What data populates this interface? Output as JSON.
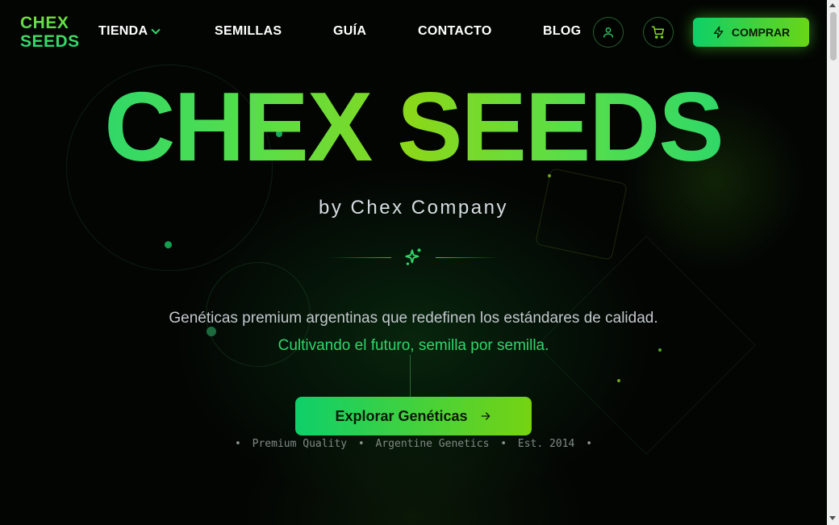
{
  "brand": {
    "line1": "CHEX",
    "line2": "SEEDS"
  },
  "nav": {
    "items": [
      {
        "label": "TIENDA",
        "has_dropdown": true
      },
      {
        "label": "SEMILLAS"
      },
      {
        "label": "GUÍA"
      },
      {
        "label": "CONTACTO"
      },
      {
        "label": "BLOG"
      }
    ],
    "account_icon": "user-icon",
    "cart_icon": "shopping-cart-icon",
    "buy_label": "COMPRAR",
    "buy_icon": "lightning-icon"
  },
  "hero": {
    "title": "CHEX SEEDS",
    "subtitle": "by Chex Company",
    "divider_icon": "sparkles-icon",
    "tagline": "Genéticas premium argentinas que redefinen los estándares de calidad.",
    "tagline_accent": "Cultivando el futuro, semilla por semilla.",
    "cta_label": "Explorar Genéticas",
    "cta_icon": "arrow-right-icon",
    "meta": [
      "Premium Quality",
      "Argentine Genetics",
      "Est. 2014"
    ]
  },
  "colors": {
    "background": "#030503",
    "accent_green": "#0fcf68",
    "accent_lime": "#76d312",
    "text_light": "#d6dce0"
  }
}
